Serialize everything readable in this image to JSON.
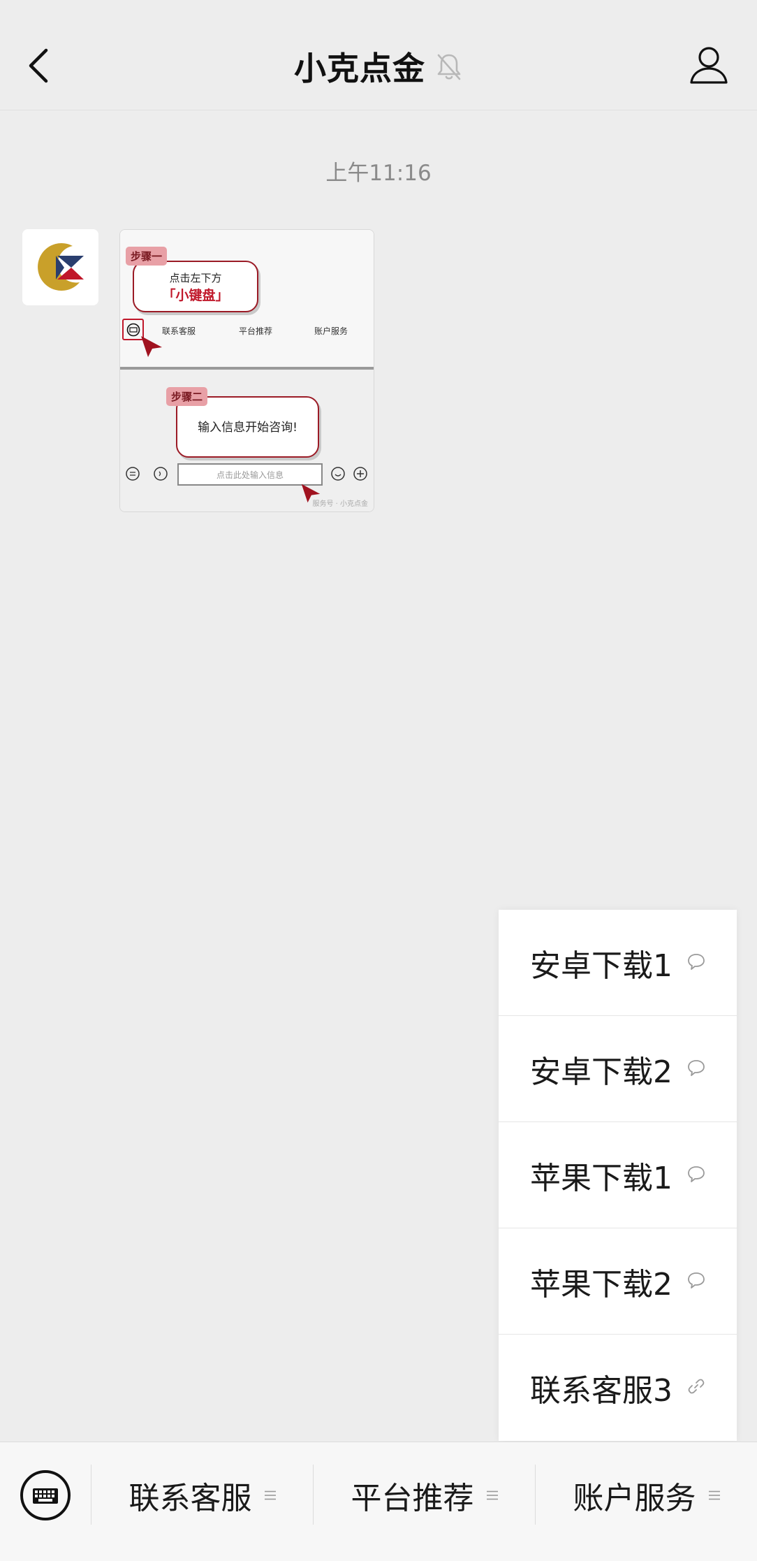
{
  "header": {
    "title": "小克点金",
    "back_icon": "back-arrow-icon",
    "mute_icon": "bell-muted-icon",
    "profile_icon": "person-icon"
  },
  "chat": {
    "timestamp": "上午11:16",
    "message": {
      "sender_avatar": "xiaoke-logo",
      "image": {
        "step1_tag": "步骤一",
        "step1_line1": "点击左下方",
        "step1_line2": "「小键盘」",
        "menu": [
          "联系客服",
          "平台推荐",
          "账户服务"
        ],
        "step2_tag": "步骤二",
        "step2_text": "输入信息开始咨询!",
        "input_placeholder": "点击此处输入信息",
        "footer": "服务号 · 小克点金"
      }
    }
  },
  "popup_menu": {
    "items": [
      {
        "label": "安卓下载1",
        "icon": "message-icon"
      },
      {
        "label": "安卓下载2",
        "icon": "message-icon"
      },
      {
        "label": "苹果下载1",
        "icon": "message-icon"
      },
      {
        "label": "苹果下载2",
        "icon": "message-icon"
      },
      {
        "label": "联系客服3",
        "icon": "link-icon"
      }
    ]
  },
  "bottom_menu": {
    "keyboard_icon": "keyboard-icon",
    "items": [
      {
        "label": "联系客服"
      },
      {
        "label": "平台推荐"
      },
      {
        "label": "账户服务"
      }
    ]
  },
  "colors": {
    "background": "#ededed",
    "brand_red": "#c0172a",
    "brand_gold": "#c9a02a",
    "brand_navy": "#2a3e6e"
  }
}
